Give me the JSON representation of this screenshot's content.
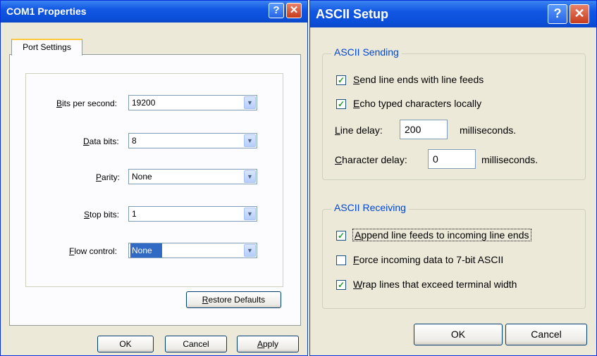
{
  "com1": {
    "title": "COM1 Properties",
    "tab": "Port Settings",
    "fields": [
      {
        "label_u": "B",
        "label_rest": "its per second:",
        "value": "19200"
      },
      {
        "label_u": "D",
        "label_rest": "ata bits:",
        "value": "8"
      },
      {
        "label_u": "P",
        "label_rest": "arity:",
        "value": "None"
      },
      {
        "label_u": "S",
        "label_rest": "top bits:",
        "value": "1"
      },
      {
        "label_u": "F",
        "label_rest": "low control:",
        "value": "None"
      }
    ],
    "restore_u": "R",
    "restore_rest": "estore Defaults",
    "ok": "OK",
    "cancel": "Cancel",
    "apply_u": "A",
    "apply_rest": "pply"
  },
  "ascii": {
    "title": "ASCII Setup",
    "sending_label": "ASCII Sending",
    "send_line_ends_u": "S",
    "send_line_ends_rest": "end line ends with line feeds",
    "echo_u": "E",
    "echo_rest": "cho typed characters locally",
    "line_delay_u": "L",
    "line_delay_rest": "ine delay:",
    "line_delay_value": "200",
    "line_delay_unit": "milliseconds.",
    "char_delay_u": "C",
    "char_delay_rest": "haracter delay:",
    "char_delay_value": "0",
    "char_delay_unit": "milliseconds.",
    "receiving_label": "ASCII Receiving",
    "append_u": "A",
    "append_rest": "ppend line feeds to incoming line ends",
    "force_u": "F",
    "force_rest": "orce incoming data to 7-bit ASCII",
    "wrap_u": "W",
    "wrap_rest": "rap lines that exceed terminal width",
    "ok": "OK",
    "cancel": "Cancel"
  },
  "checks": {
    "send_line_ends": true,
    "echo": true,
    "append": true,
    "force": false,
    "wrap": true
  },
  "icons": {
    "help": "?",
    "close": "✕",
    "check": "✓",
    "dropdown": "▼"
  }
}
